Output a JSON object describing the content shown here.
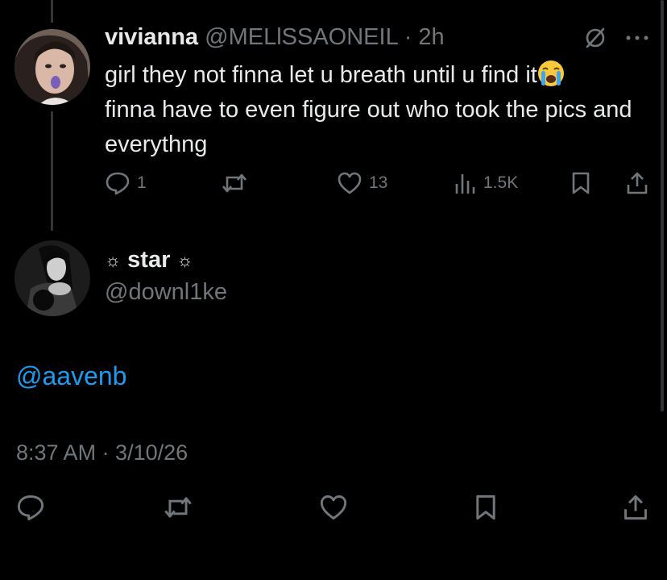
{
  "parent_tweet": {
    "display_name": "vivianna",
    "handle": "@MELlSSAONEIL",
    "separator": "·",
    "time_ago": "2h",
    "text_part1": "girl they not finna let u breath until u find it",
    "text_part2": "finna have to even figure out who took the pics and everythng",
    "replies": "1",
    "likes": "13",
    "views": "1.5K",
    "icons": [
      "hide-icon",
      "more-icon",
      "reply-icon",
      "retweet-icon",
      "like-icon",
      "views-icon",
      "bookmark-icon",
      "share-icon"
    ]
  },
  "reply_tweet": {
    "sparkle_left": "☼",
    "display_name": "star",
    "sparkle_right": "☼",
    "handle": "@downl1ke",
    "mention": "@aavenb",
    "timestamp": "8:37 AM · 3/10/26"
  },
  "colors": {
    "background": "#000000",
    "text": "#e7e9ea",
    "muted": "#71767b",
    "link": "#1d9bf0",
    "thread_line": "#333639"
  }
}
